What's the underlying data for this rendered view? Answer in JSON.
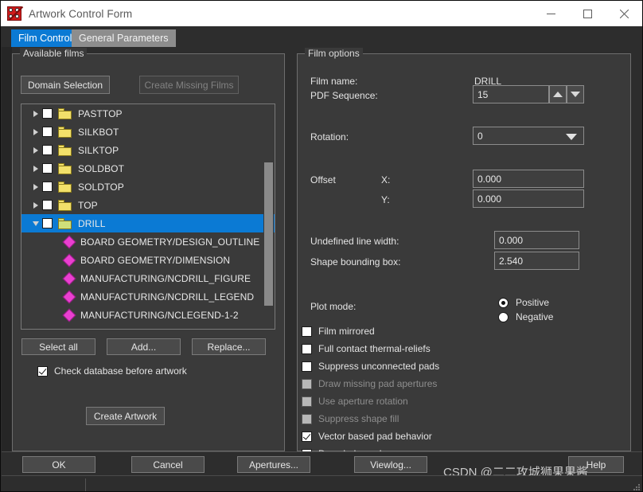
{
  "window": {
    "title": "Artwork Control Form",
    "icon": "artwork-app-icon",
    "minimize_label": "—",
    "maximize_label": "□",
    "close_label": "✕"
  },
  "tabs": [
    {
      "label": "Film Control",
      "active": true
    },
    {
      "label": "General Parameters",
      "active": false
    }
  ],
  "available_films": {
    "legend": "Available films",
    "buttons": {
      "domain_selection": "Domain Selection",
      "create_missing_films": "Create Missing Films",
      "create_missing_films_disabled": true
    },
    "tree": [
      {
        "label": "PASTTOP",
        "type": "folder",
        "expanded": false,
        "checked": false,
        "selected": false
      },
      {
        "label": "SILKBOT",
        "type": "folder",
        "expanded": false,
        "checked": false,
        "selected": false
      },
      {
        "label": "SILKTOP",
        "type": "folder",
        "expanded": false,
        "checked": false,
        "selected": false
      },
      {
        "label": "SOLDBOT",
        "type": "folder",
        "expanded": false,
        "checked": false,
        "selected": false
      },
      {
        "label": "SOLDTOP",
        "type": "folder",
        "expanded": false,
        "checked": false,
        "selected": false
      },
      {
        "label": "TOP",
        "type": "folder",
        "expanded": false,
        "checked": false,
        "selected": false
      },
      {
        "label": "DRILL",
        "type": "folder-open",
        "expanded": true,
        "checked": false,
        "selected": true
      },
      {
        "label": "BOARD GEOMETRY/DESIGN_OUTLINE",
        "type": "subclass",
        "child": true
      },
      {
        "label": "BOARD GEOMETRY/DIMENSION",
        "type": "subclass",
        "child": true
      },
      {
        "label": "MANUFACTURING/NCDRILL_FIGURE",
        "type": "subclass",
        "child": true
      },
      {
        "label": "MANUFACTURING/NCDRILL_LEGEND",
        "type": "subclass",
        "child": true
      },
      {
        "label": "MANUFACTURING/NCLEGEND-1-2",
        "type": "subclass",
        "child": true
      }
    ],
    "list_buttons": {
      "select_all": "Select all",
      "add": "Add...",
      "replace": "Replace..."
    },
    "check_database": {
      "label": "Check database before artwork",
      "checked": true
    },
    "create_artwork": "Create Artwork"
  },
  "film_options": {
    "legend": "Film options",
    "film_name_label": "Film name:",
    "film_name_value": "DRILL",
    "pdf_sequence_label": "PDF Sequence:",
    "pdf_sequence_value": "15",
    "rotation_label": "Rotation:",
    "rotation_value": "0",
    "offset_label": "Offset",
    "offset_x_label": "X:",
    "offset_x_value": "0.000",
    "offset_y_label": "Y:",
    "offset_y_value": "0.000",
    "undefined_line_width_label": "Undefined line width:",
    "undefined_line_width_value": "0.000",
    "shape_bounding_box_label": "Shape bounding box:",
    "shape_bounding_box_value": "2.540",
    "plot_mode_label": "Plot mode:",
    "plot_mode_options": [
      {
        "label": "Positive",
        "selected": true
      },
      {
        "label": "Negative",
        "selected": false
      }
    ],
    "checkboxes": [
      {
        "label": "Film mirrored",
        "checked": false,
        "disabled": false
      },
      {
        "label": "Full contact thermal-reliefs",
        "checked": false,
        "disabled": false
      },
      {
        "label": "Suppress unconnected pads",
        "checked": false,
        "disabled": false
      },
      {
        "label": "Draw missing pad apertures",
        "checked": false,
        "disabled": true
      },
      {
        "label": "Use aperture rotation",
        "checked": false,
        "disabled": true
      },
      {
        "label": "Suppress shape fill",
        "checked": false,
        "disabled": true
      },
      {
        "label": "Vector based pad behavior",
        "checked": true,
        "disabled": false
      },
      {
        "label": "Draw holes only",
        "checked": false,
        "disabled": false
      }
    ]
  },
  "dialog_buttons": {
    "ok": "OK",
    "cancel": "Cancel",
    "apertures": "Apertures...",
    "viewlog": "Viewlog...",
    "help": "Help"
  },
  "watermark": "CSDN @二二攻城狮果果酱",
  "colors": {
    "accent": "#0b7ad4",
    "window_bg": "#2d2d2d",
    "panel_bg": "#3a3a3a",
    "titlebar_bg": "#ffffff",
    "folder": "#f2e06a",
    "subclass": "#ea3fd0"
  }
}
